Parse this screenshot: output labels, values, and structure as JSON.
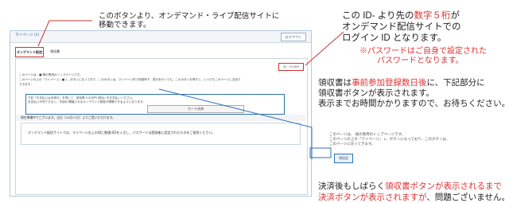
{
  "window": {
    "title": "マイページ (1)",
    "logout_label": "ログアウト"
  },
  "tabs": [
    {
      "label": "オンデマンド配信"
    },
    {
      "label": "領収書"
    }
  ],
  "content": {
    "id_label": "ID : 51469",
    "line1": "このページは、■              様の専用のトップページです。",
    "line2": "このページの上の「マイページ」■                        1、ボタンになっており、このボタンは、マイページ内で何度押下、表示を行っても、このボタンを押すと、いつでもこのページにお戻り",
    "line3": "できます。",
    "pay_line1": "下記「お支払いは手続き」を押して、参加費 5,000円 (税込) をお支払いください。",
    "pay_line2": "お支払いが完了すると、今回の 開催されるオンデマンド配信が視聴できるようになります。",
    "card_button": "カード決済",
    "notice": "現在準備中でございます。当日（10月11日）よりご覧いただけます。",
    "info": "オンデマンド配信サイトでは、マイページ右上のIDに数値(ID)を入力し、パスワードは登録後に設定されたものをご使用ください。"
  },
  "annotations": {
    "top": {
      "line1": "このボタンより、オンデマンド・ライブ配信サイトに",
      "line2": "移動できます。"
    },
    "right_top": {
      "line1_a": "この ID- より先の",
      "line1_red": "数字５桁",
      "line1_b": "が",
      "line2": "オンデマンド配信サイトでの",
      "line3": "ログイン ID となります。",
      "pw1": "※パスワードはご自身で設定された",
      "pw2": "パスワードとなります。"
    },
    "receipt": {
      "line1_a": "領収書は",
      "line1_red": "事前参加登録数日後",
      "line1_b": "に、下記部分に",
      "line2": "領収書ボタンが表示されます。",
      "line3": "表示までお時間かかりますので、お待ちください。"
    },
    "inset": {
      "t1": "このページは、                  様の専用のトップページです。",
      "t2": "このページの上の「マイページ」          1、ボタンになっており、このボタンは、",
      "t3": "このページに戻ってきます。",
      "receipt_btn": "領収証"
    },
    "bottom": {
      "line1_a": "決済後もしばらく",
      "line1_red": "領収書ボタンが表示されるまで",
      "line2_red": "決済ボタンが表示されますが",
      "line2_b": "、問題ございません。"
    }
  },
  "colors": {
    "accent_red": "#e03030",
    "line_blue": "#2f6fb3",
    "box_red": "#cc3333"
  }
}
